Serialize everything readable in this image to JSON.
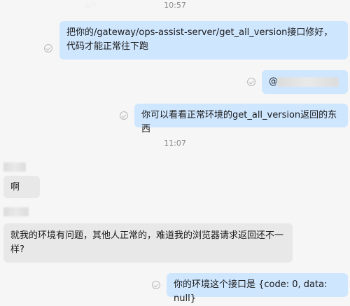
{
  "timestamps": [
    "10:57",
    "11:07"
  ],
  "messages": [
    {
      "text": "把你的/gateway/ops-assist-server/get_all_version接口修好，代码才能正常往下跑"
    },
    {
      "text": "@",
      "redacted_name": "████████"
    },
    {
      "text": "你可以看看正常环境的get_all_version返回的东西"
    },
    {
      "text": "啊"
    },
    {
      "text": "就我的环境有问题，其他人正常的，难道我的浏览器请求返回还不一样?"
    },
    {
      "text": "你的环境这个接口是 {code: 0, data: null}"
    }
  ]
}
